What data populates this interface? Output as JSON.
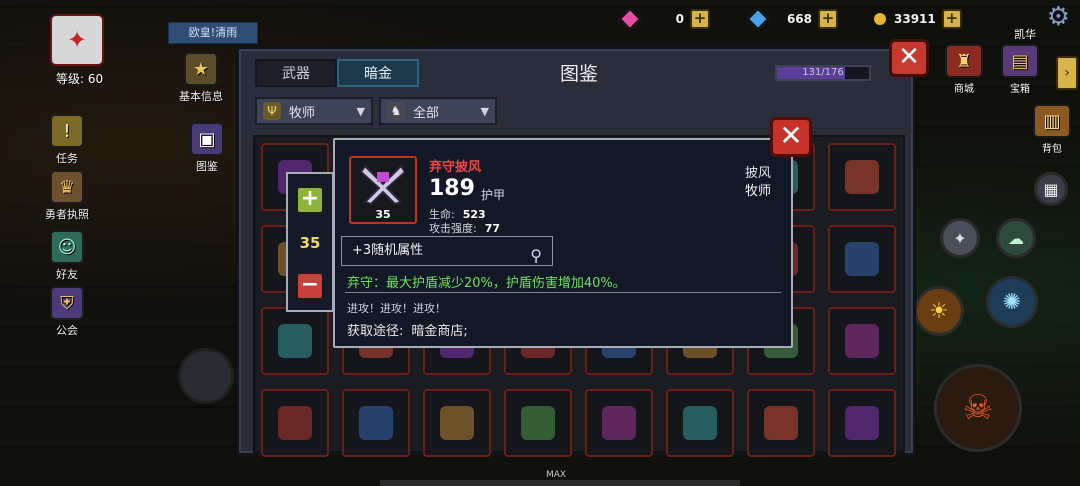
{
  "hud": {
    "resources": [
      {
        "icon": "pink-gem-icon",
        "value": "0",
        "color": "#e24fa3"
      },
      {
        "icon": "blue-gem-icon",
        "value": "668",
        "color": "#4aa3e8"
      },
      {
        "icon": "gold-coin-icon",
        "value": "33911",
        "color": "#e6b631"
      }
    ],
    "player_level": "等级: 60",
    "notice": "欧皇!清雨",
    "left_menu": [
      "基本信息",
      "图鉴",
      "任务",
      "勇者执照",
      "好友",
      "公会"
    ],
    "right_menu": [
      "商城",
      "宝箱",
      "背包"
    ],
    "right_top_label": "凯华",
    "max_label": "MAX"
  },
  "codex": {
    "tabs": [
      "武器",
      "暗金"
    ],
    "active_tab": 1,
    "title": "图鉴",
    "progress": {
      "text": "131/176",
      "fraction": 0.744
    },
    "filter_class": "牧师",
    "filter_all": "全部"
  },
  "detail": {
    "name": "弃守披风",
    "armor": "189",
    "armor_label": "护甲",
    "stats": [
      {
        "label": "生命:",
        "value": "523"
      },
      {
        "label": "攻击强度:",
        "value": "77"
      }
    ],
    "item_level": "35",
    "category": "披风",
    "class": "牧师",
    "random_attr": "+3随机属性",
    "effect": "弃守：最大护盾减少20%，护盾伤害增加40%。",
    "flavor": "进攻！进攻！进攻！",
    "source_label": "获取途径:",
    "source_value": "暗金商店;",
    "adjust_level": "35"
  },
  "colors": {
    "item_name": "#f04646",
    "effect": "#6fe05f",
    "close_button": "#c9322a",
    "slot_border": "#6b1f16"
  }
}
